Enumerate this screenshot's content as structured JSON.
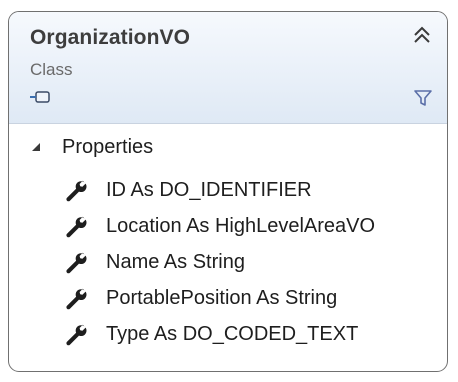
{
  "class": {
    "name": "OrganizationVO",
    "stereotype": "Class"
  },
  "icons": {
    "collapse": "double-chevron-up-icon",
    "visibility": "public-visibility-icon",
    "filter": "filter-funnel-icon",
    "section_toggle": "triangle-expanded-icon",
    "property": "wrench-icon"
  },
  "compartment": {
    "label": "Properties",
    "expanded": true,
    "items": [
      {
        "text": "ID As DO_IDENTIFIER"
      },
      {
        "text": "Location As HighLevelAreaVO"
      },
      {
        "text": "Name As String"
      },
      {
        "text": "PortablePosition As String"
      },
      {
        "text": "Type As DO_CODED_TEXT"
      }
    ]
  },
  "colors": {
    "header_gradient_top": "#f6f9fd",
    "header_gradient_bottom": "#dfe9f5",
    "border": "#707070",
    "filter_icon": "#5b6fa8"
  }
}
